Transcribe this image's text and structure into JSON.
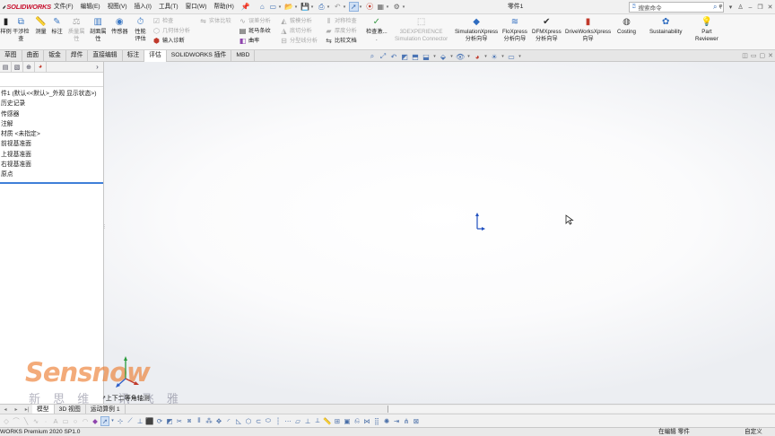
{
  "app": {
    "logo_text": "SOLIDWORKS",
    "document_title": "零件1",
    "search_placeholder": "搜索命令"
  },
  "menu": [
    "文件(F)",
    "编辑(E)",
    "视图(V)",
    "插入(I)",
    "工具(T)",
    "窗口(W)",
    "帮助(H)"
  ],
  "ribbon": {
    "left_cut": "样例",
    "interference": [
      "干涉检",
      "查"
    ],
    "measure": "测量",
    "markup": "标注",
    "mass_props": [
      "质量属",
      "性"
    ],
    "section_props": [
      "剖面属",
      "性"
    ],
    "sensor": "传感器",
    "perf_eval": [
      "性能",
      "评估"
    ],
    "check": "检查",
    "geometry_analysis": "几何体分析",
    "import_diagnostics": "输入诊断",
    "compare_bodies": "实体比较",
    "deviation": "误差分析",
    "zebra": "斑马条纹",
    "curvature": "曲率",
    "draft": "拔模分析",
    "undercut": "底切分析",
    "parting_line": "分型线分析",
    "symmetry": "对称检查",
    "thickness": "厚度分析",
    "compare_docs": "比较文档",
    "check_active": [
      "检查激...",
      "."
    ],
    "sim_connector": [
      "3DEXPERIENCE",
      "Simulation Connector"
    ],
    "simxpress": [
      "SimulationXpress",
      "分析向导"
    ],
    "floxpress": [
      "FloXpress",
      "分析向导"
    ],
    "dfmxpress": [
      "DFMXpress",
      "分析向导"
    ],
    "driveworks": [
      "DriveWorksXpress",
      "向导"
    ],
    "costing": "Costing",
    "sustainability": "Sustainability",
    "part_reviewer": [
      "Part",
      "Reviewer"
    ]
  },
  "tabs": [
    "草图",
    "曲面",
    "钣金",
    "焊件",
    "直接编辑",
    "标注",
    "评估",
    "SOLIDWORKS 插件",
    "MBD"
  ],
  "active_tab": "评估",
  "tree": {
    "root": "件1 (默认<<默认>_外观 显示状态>)",
    "items": [
      "历史记录",
      "传感器",
      "注解",
      "材质 <未指定>",
      "前视基准面",
      "上视基准面",
      "右视基准面",
      "原点"
    ]
  },
  "view_label": "*上下二等角轴测",
  "watermark": {
    "brand": "Sensnow",
    "tagline": "新 思 维 · 讯 飞 雅"
  },
  "bottom_tabs": [
    "模型",
    "3D 视图",
    "运动算例 1"
  ],
  "active_bottom_tab": "模型",
  "status": {
    "left": "WORKS Premium 2020 SP1.0",
    "mid": "在编辑 零件",
    "right": "自定义"
  }
}
